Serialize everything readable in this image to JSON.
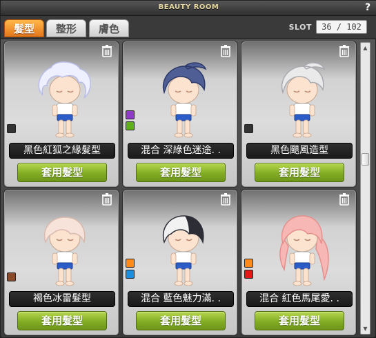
{
  "window": {
    "title": "BEAUTY ROOM",
    "help": "?"
  },
  "tabs": [
    {
      "label": "髮型",
      "active": true
    },
    {
      "label": "整形",
      "active": false
    },
    {
      "label": "膚色",
      "active": false
    }
  ],
  "slot": {
    "label": "SLOT",
    "value": "36 / 102"
  },
  "apply_label": "套用髮型",
  "items": [
    {
      "name": "黑色紅狐之緣髮型",
      "swatches": [
        "#333333"
      ],
      "hair": "#eef0ff",
      "hair_dark": "#b9bde8",
      "style": "spiky"
    },
    {
      "name": "混合  深綠色迷途. .",
      "swatches": [
        "#8e3cc8",
        "#5fb01a"
      ],
      "hair": "#4f5f96",
      "hair_dark": "#2c3868",
      "style": "swept"
    },
    {
      "name": "黑色颶風造型",
      "swatches": [
        "#333333"
      ],
      "hair": "#eaeaea",
      "hair_dark": "#a9a9b0",
      "style": "swept"
    },
    {
      "name": "褐色冰雷髮型",
      "swatches": [
        "#8b4a2a"
      ],
      "hair": "#f7e3da",
      "hair_dark": "#d9b9ad",
      "style": "short"
    },
    {
      "name": "混合  藍色魅力滿. .",
      "swatches": [
        "#ff8a1a",
        "#1c8ee0"
      ],
      "hair": "#f2f2f2",
      "hair_dark": "#2d2d36",
      "style": "split"
    },
    {
      "name": "混合  紅色馬尾愛. .",
      "swatches": [
        "#ff8a1a",
        "#e01818"
      ],
      "hair": "#f7b7b4",
      "hair_dark": "#e58f8c",
      "style": "ponytail"
    }
  ],
  "colors": {
    "tab_active": "#f08a24",
    "apply_green": "#8ab52a",
    "title_text": "#e8d9a0"
  },
  "icons": {
    "trash": "trash-icon",
    "scroll_up": "arrow-up-icon",
    "scroll_down": "arrow-down-icon"
  }
}
